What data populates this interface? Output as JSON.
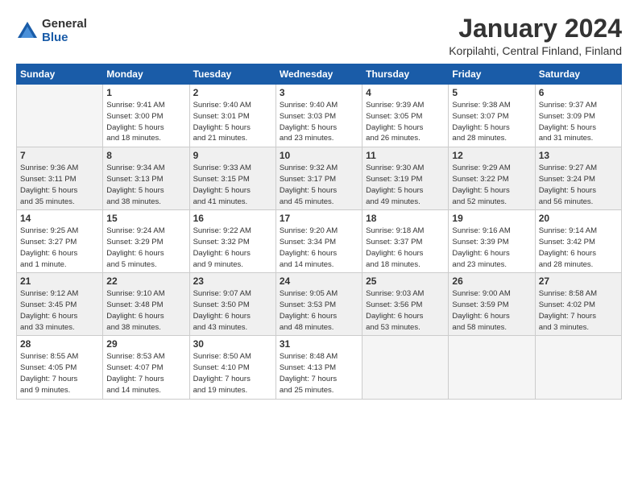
{
  "logo": {
    "general": "General",
    "blue": "Blue"
  },
  "header": {
    "title": "January 2024",
    "subtitle": "Korpilahti, Central Finland, Finland"
  },
  "weekdays": [
    "Sunday",
    "Monday",
    "Tuesday",
    "Wednesday",
    "Thursday",
    "Friday",
    "Saturday"
  ],
  "weeks": [
    [
      {
        "num": "",
        "info": ""
      },
      {
        "num": "1",
        "info": "Sunrise: 9:41 AM\nSunset: 3:00 PM\nDaylight: 5 hours\nand 18 minutes."
      },
      {
        "num": "2",
        "info": "Sunrise: 9:40 AM\nSunset: 3:01 PM\nDaylight: 5 hours\nand 21 minutes."
      },
      {
        "num": "3",
        "info": "Sunrise: 9:40 AM\nSunset: 3:03 PM\nDaylight: 5 hours\nand 23 minutes."
      },
      {
        "num": "4",
        "info": "Sunrise: 9:39 AM\nSunset: 3:05 PM\nDaylight: 5 hours\nand 26 minutes."
      },
      {
        "num": "5",
        "info": "Sunrise: 9:38 AM\nSunset: 3:07 PM\nDaylight: 5 hours\nand 28 minutes."
      },
      {
        "num": "6",
        "info": "Sunrise: 9:37 AM\nSunset: 3:09 PM\nDaylight: 5 hours\nand 31 minutes."
      }
    ],
    [
      {
        "num": "7",
        "info": "Sunrise: 9:36 AM\nSunset: 3:11 PM\nDaylight: 5 hours\nand 35 minutes."
      },
      {
        "num": "8",
        "info": "Sunrise: 9:34 AM\nSunset: 3:13 PM\nDaylight: 5 hours\nand 38 minutes."
      },
      {
        "num": "9",
        "info": "Sunrise: 9:33 AM\nSunset: 3:15 PM\nDaylight: 5 hours\nand 41 minutes."
      },
      {
        "num": "10",
        "info": "Sunrise: 9:32 AM\nSunset: 3:17 PM\nDaylight: 5 hours\nand 45 minutes."
      },
      {
        "num": "11",
        "info": "Sunrise: 9:30 AM\nSunset: 3:19 PM\nDaylight: 5 hours\nand 49 minutes."
      },
      {
        "num": "12",
        "info": "Sunrise: 9:29 AM\nSunset: 3:22 PM\nDaylight: 5 hours\nand 52 minutes."
      },
      {
        "num": "13",
        "info": "Sunrise: 9:27 AM\nSunset: 3:24 PM\nDaylight: 5 hours\nand 56 minutes."
      }
    ],
    [
      {
        "num": "14",
        "info": "Sunrise: 9:25 AM\nSunset: 3:27 PM\nDaylight: 6 hours\nand 1 minute."
      },
      {
        "num": "15",
        "info": "Sunrise: 9:24 AM\nSunset: 3:29 PM\nDaylight: 6 hours\nand 5 minutes."
      },
      {
        "num": "16",
        "info": "Sunrise: 9:22 AM\nSunset: 3:32 PM\nDaylight: 6 hours\nand 9 minutes."
      },
      {
        "num": "17",
        "info": "Sunrise: 9:20 AM\nSunset: 3:34 PM\nDaylight: 6 hours\nand 14 minutes."
      },
      {
        "num": "18",
        "info": "Sunrise: 9:18 AM\nSunset: 3:37 PM\nDaylight: 6 hours\nand 18 minutes."
      },
      {
        "num": "19",
        "info": "Sunrise: 9:16 AM\nSunset: 3:39 PM\nDaylight: 6 hours\nand 23 minutes."
      },
      {
        "num": "20",
        "info": "Sunrise: 9:14 AM\nSunset: 3:42 PM\nDaylight: 6 hours\nand 28 minutes."
      }
    ],
    [
      {
        "num": "21",
        "info": "Sunrise: 9:12 AM\nSunset: 3:45 PM\nDaylight: 6 hours\nand 33 minutes."
      },
      {
        "num": "22",
        "info": "Sunrise: 9:10 AM\nSunset: 3:48 PM\nDaylight: 6 hours\nand 38 minutes."
      },
      {
        "num": "23",
        "info": "Sunrise: 9:07 AM\nSunset: 3:50 PM\nDaylight: 6 hours\nand 43 minutes."
      },
      {
        "num": "24",
        "info": "Sunrise: 9:05 AM\nSunset: 3:53 PM\nDaylight: 6 hours\nand 48 minutes."
      },
      {
        "num": "25",
        "info": "Sunrise: 9:03 AM\nSunset: 3:56 PM\nDaylight: 6 hours\nand 53 minutes."
      },
      {
        "num": "26",
        "info": "Sunrise: 9:00 AM\nSunset: 3:59 PM\nDaylight: 6 hours\nand 58 minutes."
      },
      {
        "num": "27",
        "info": "Sunrise: 8:58 AM\nSunset: 4:02 PM\nDaylight: 7 hours\nand 3 minutes."
      }
    ],
    [
      {
        "num": "28",
        "info": "Sunrise: 8:55 AM\nSunset: 4:05 PM\nDaylight: 7 hours\nand 9 minutes."
      },
      {
        "num": "29",
        "info": "Sunrise: 8:53 AM\nSunset: 4:07 PM\nDaylight: 7 hours\nand 14 minutes."
      },
      {
        "num": "30",
        "info": "Sunrise: 8:50 AM\nSunset: 4:10 PM\nDaylight: 7 hours\nand 19 minutes."
      },
      {
        "num": "31",
        "info": "Sunrise: 8:48 AM\nSunset: 4:13 PM\nDaylight: 7 hours\nand 25 minutes."
      },
      {
        "num": "",
        "info": ""
      },
      {
        "num": "",
        "info": ""
      },
      {
        "num": "",
        "info": ""
      }
    ]
  ]
}
